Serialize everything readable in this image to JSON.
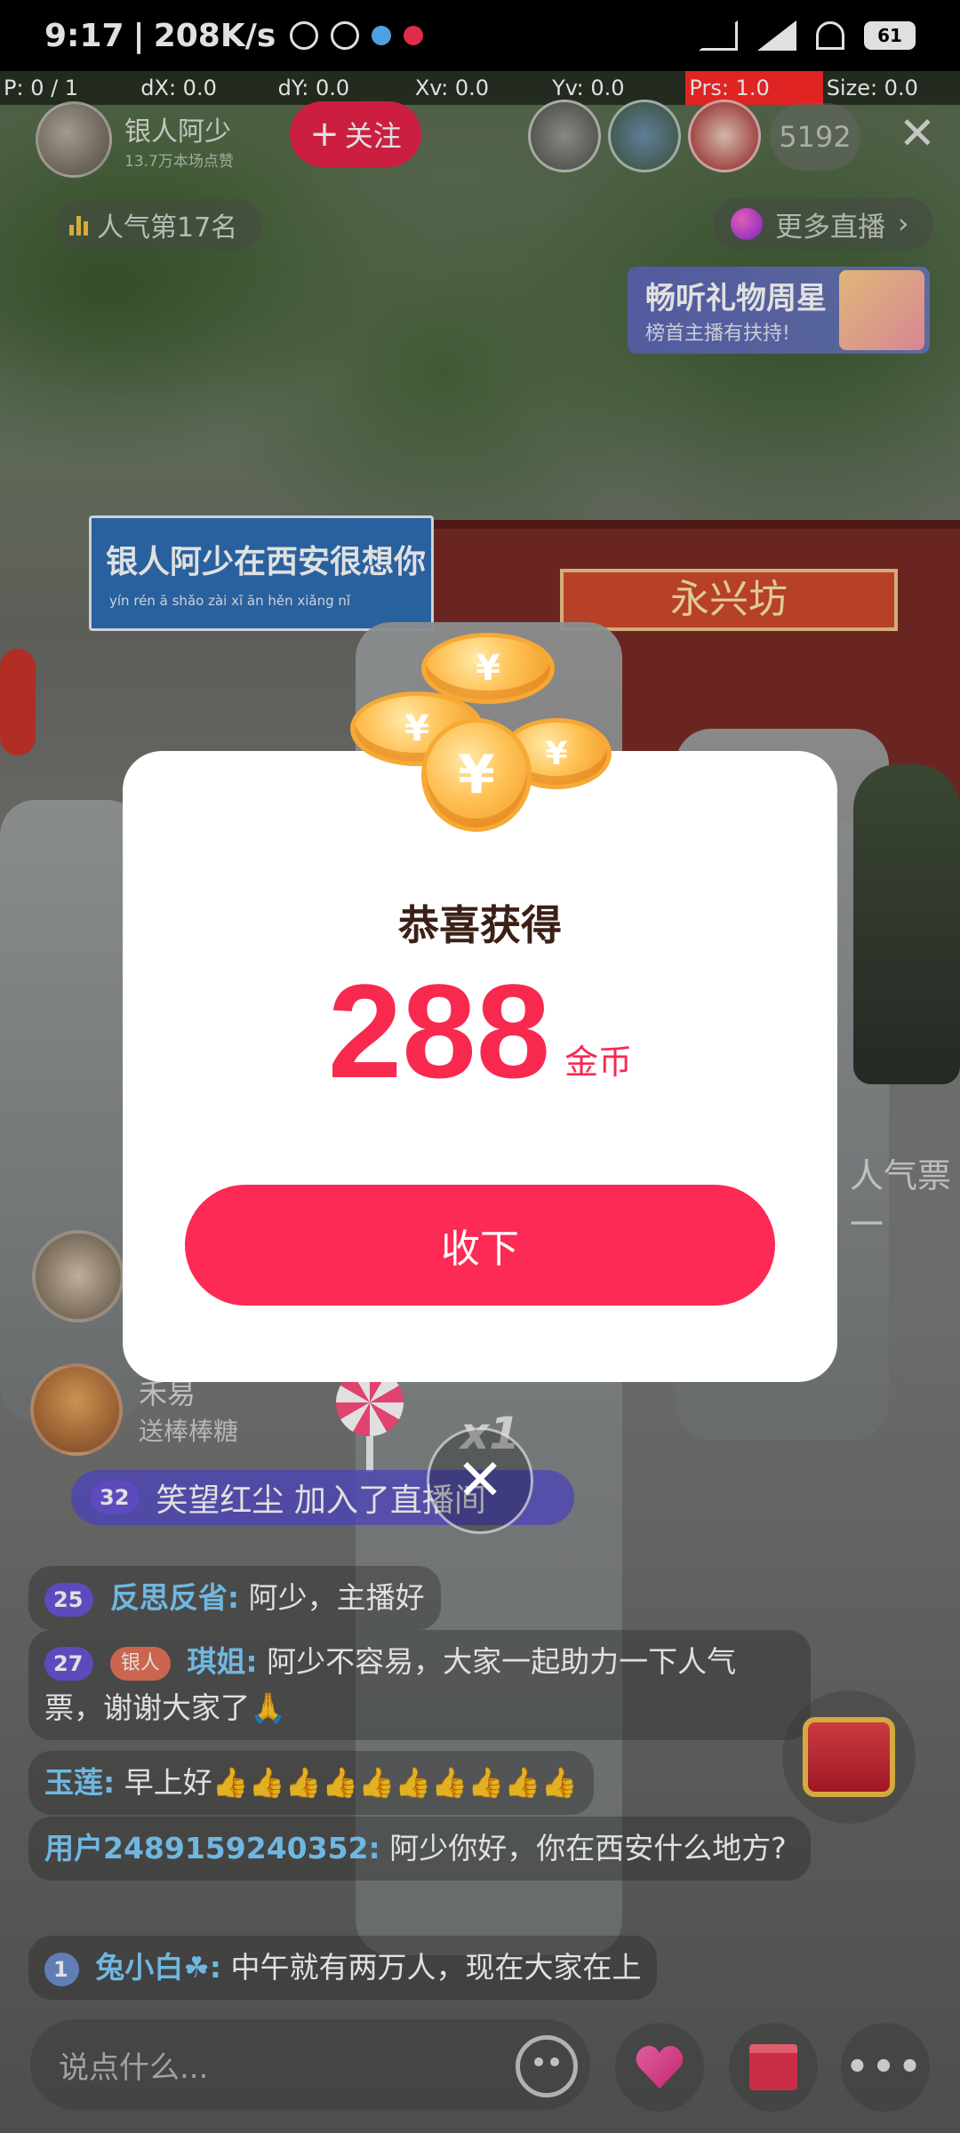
{
  "status_bar": {
    "time": "9:17",
    "speed": "208K/s",
    "battery": "61"
  },
  "debug_overlay": {
    "p": "P: 0 / 1",
    "dx": "dX: 0.0",
    "dy": "dY: 0.0",
    "xv": "Xv: 0.0",
    "yv": "Yv: 0.0",
    "prs": "Prs: 1.0",
    "size": "Size: 0.0"
  },
  "host": {
    "name": "银人阿少",
    "sub": "13.7万本场点赞",
    "follow_label": "关注",
    "follow_icon": "plus-icon"
  },
  "viewers": {
    "count": "5192"
  },
  "rank": {
    "label": "人气第17名"
  },
  "more_live": {
    "label": "更多直播"
  },
  "gift_banner": {
    "title": "畅听礼物周星",
    "subtitle": "榜首主播有扶持!"
  },
  "scene": {
    "street_sign": "银人阿少在西安很想你",
    "street_sign_sub": "yín rén ā shǎo zài xī ān hěn xiǎng nǐ",
    "shop_sign": "永兴坊",
    "side_text": "人气票一"
  },
  "modal": {
    "title": "恭喜获得",
    "amount": "288",
    "unit": "金币",
    "accept_label": "收下",
    "coin_glyph": "¥"
  },
  "gifter": {
    "name": "禾易",
    "action": "送棒棒糖",
    "multiplier": "x1"
  },
  "join": {
    "level": "32",
    "text": "笑望红尘 加入了直播间"
  },
  "chat": [
    {
      "level": "25",
      "name": "反思反省:",
      "text": "阿少，主播好"
    },
    {
      "level": "27",
      "tag": "银人",
      "name": "琪姐:",
      "text": "阿少不容易，大家一起助力一下人气票，谢谢大家了🙏"
    },
    {
      "name": "玉莲:",
      "text": "早上好👍👍👍👍👍👍👍👍👍👍"
    },
    {
      "name": "用户2489159240352:",
      "text": "阿少你好，你在西安什么地方?"
    },
    {
      "level": "1",
      "name": "兔小白☘:",
      "text": "中午就有两万人，现在大家在上"
    }
  ],
  "bottom": {
    "input_placeholder": "说点什么..."
  }
}
